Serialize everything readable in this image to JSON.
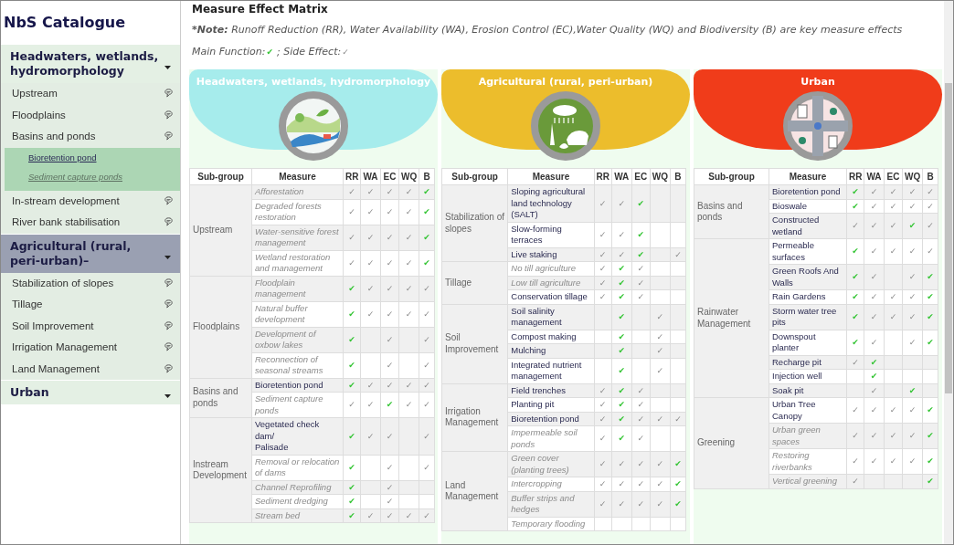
{
  "sidebar": {
    "title": "NbS Catalogue",
    "groups": [
      {
        "label": "Headwaters, wetlands, hydromorphology",
        "expanded": true,
        "selected": false,
        "items": [
          {
            "label": "Upstream",
            "expanded": false
          },
          {
            "label": "Floodplains",
            "expanded": false
          },
          {
            "label": "Basins and ponds",
            "expanded": true,
            "children": [
              {
                "label": "Bioretention pond",
                "disabled": false
              },
              {
                "label": "Sediment capture ponds",
                "disabled": true
              }
            ]
          },
          {
            "label": "In-stream development",
            "expanded": false
          },
          {
            "label": "River bank stabilisation",
            "expanded": false
          }
        ]
      },
      {
        "label": "Agricultural (rural, peri-urban)–",
        "expanded": true,
        "selected": true,
        "items": [
          {
            "label": "Stabilization of slopes",
            "expanded": false
          },
          {
            "label": "Tillage",
            "expanded": false
          },
          {
            "label": "Soil Improvement",
            "expanded": false
          },
          {
            "label": "Irrigation Management",
            "expanded": false
          },
          {
            "label": "Land Management",
            "expanded": false
          }
        ]
      },
      {
        "label": "Urban",
        "expanded": false,
        "selected": false
      }
    ]
  },
  "main": {
    "title": "Measure Effect Matrix",
    "note": {
      "label": "*Note:",
      "text": "Runoff Reduction (RR), Water Availability (WA), Erosion Control (EC),Water Quality (WQ) and Biodiversity (B) are key measure effects"
    },
    "legend": [
      {
        "label": "Main Function:",
        "mark": "✔",
        "main": true
      },
      {
        "label": "; Side Effect:",
        "mark": "✓",
        "main": false
      }
    ],
    "panels": [
      {
        "title": "Headwaters, wetlands, hydromorphology",
        "color": "#a6ecec",
        "columns": [
          "Sub-group",
          "Measure",
          "RR",
          "WA",
          "EC",
          "WQ",
          "B"
        ],
        "groups": [
          {
            "name": "Upstream",
            "measures": [
              {
                "name": "Afforestation",
                "disabled": true,
                "effects": {
                  "rr": {
                    "mark": "✓",
                    "main": false
                  },
                  "wa": {
                    "mark": "✓",
                    "main": false
                  },
                  "ec": {
                    "mark": "✓",
                    "main": false
                  },
                  "wq": {
                    "mark": "✓",
                    "main": false
                  },
                  "b": {
                    "mark": "✔",
                    "main": true
                  }
                }
              },
              {
                "name": "Degraded forests restoration",
                "disabled": true,
                "effects": {
                  "rr": {
                    "mark": "✓",
                    "main": false
                  },
                  "wa": {
                    "mark": "✓",
                    "main": false
                  },
                  "ec": {
                    "mark": "✓",
                    "main": false
                  },
                  "wq": {
                    "mark": "✓",
                    "main": false
                  },
                  "b": {
                    "mark": "✔",
                    "main": true
                  }
                }
              },
              {
                "name": "Water-sensitive forest management",
                "disabled": true,
                "effects": {
                  "rr": {
                    "mark": "✓",
                    "main": false
                  },
                  "wa": {
                    "mark": "✓",
                    "main": false
                  },
                  "ec": {
                    "mark": "✓",
                    "main": false
                  },
                  "wq": {
                    "mark": "✓",
                    "main": false
                  },
                  "b": {
                    "mark": "✔",
                    "main": true
                  }
                }
              },
              {
                "name": "Wetland restoration and management",
                "disabled": true,
                "effects": {
                  "rr": {
                    "mark": "✓",
                    "main": false
                  },
                  "wa": {
                    "mark": "✓",
                    "main": false
                  },
                  "ec": {
                    "mark": "✓",
                    "main": false
                  },
                  "wq": {
                    "mark": "✓",
                    "main": false
                  },
                  "b": {
                    "mark": "✔",
                    "main": true
                  }
                }
              }
            ]
          },
          {
            "name": "Floodplains",
            "measures": [
              {
                "name": "Floodplain management",
                "disabled": true,
                "effects": {
                  "rr": {
                    "mark": "✔",
                    "main": true
                  },
                  "wa": {
                    "mark": "✓",
                    "main": false
                  },
                  "ec": {
                    "mark": "✓",
                    "main": false
                  },
                  "wq": {
                    "mark": "✓",
                    "main": false
                  },
                  "b": {
                    "mark": "✓",
                    "main": false
                  }
                }
              },
              {
                "name": "Natural buffer development",
                "disabled": true,
                "effects": {
                  "rr": {
                    "mark": "✔",
                    "main": true
                  },
                  "wa": {
                    "mark": "✓",
                    "main": false
                  },
                  "ec": {
                    "mark": "✓",
                    "main": false
                  },
                  "wq": {
                    "mark": "✓",
                    "main": false
                  },
                  "b": {
                    "mark": "✓",
                    "main": false
                  }
                }
              },
              {
                "name": "Development of oxbow lakes",
                "disabled": true,
                "effects": {
                  "rr": {
                    "mark": "✔",
                    "main": true
                  },
                  "ec": {
                    "mark": "✓",
                    "main": false
                  },
                  "b": {
                    "mark": "✓",
                    "main": false
                  }
                }
              },
              {
                "name": "Reconnection of seasonal streams",
                "disabled": true,
                "effects": {
                  "rr": {
                    "mark": "✔",
                    "main": true
                  },
                  "ec": {
                    "mark": "✓",
                    "main": false
                  },
                  "b": {
                    "mark": "✓",
                    "main": false
                  }
                }
              }
            ]
          },
          {
            "name": "Basins and ponds",
            "measures": [
              {
                "name": "Bioretention pond",
                "disabled": false,
                "effects": {
                  "rr": {
                    "mark": "✔",
                    "main": true
                  },
                  "wa": {
                    "mark": "✓",
                    "main": false
                  },
                  "ec": {
                    "mark": "✓",
                    "main": false
                  },
                  "wq": {
                    "mark": "✓",
                    "main": false
                  },
                  "b": {
                    "mark": "✓",
                    "main": false
                  }
                }
              },
              {
                "name": "Sediment capture ponds",
                "disabled": true,
                "effects": {
                  "rr": {
                    "mark": "✓",
                    "main": false
                  },
                  "wa": {
                    "mark": "✓",
                    "main": false
                  },
                  "ec": {
                    "mark": "✔",
                    "main": true
                  },
                  "wq": {
                    "mark": "✓",
                    "main": false
                  },
                  "b": {
                    "mark": "✓",
                    "main": false
                  }
                }
              }
            ]
          },
          {
            "name": "Instream Development",
            "measures": [
              {
                "name": "Vegetated check dam/\nPalisade",
                "disabled": false,
                "effects": {
                  "rr": {
                    "mark": "✔",
                    "main": true
                  },
                  "wa": {
                    "mark": "✓",
                    "main": false
                  },
                  "ec": {
                    "mark": "✓",
                    "main": false
                  },
                  "b": {
                    "mark": "✓",
                    "main": false
                  }
                }
              },
              {
                "name": "Removal or relocation of dams",
                "disabled": true,
                "effects": {
                  "rr": {
                    "mark": "✔",
                    "main": true
                  },
                  "ec": {
                    "mark": "✓",
                    "main": false
                  },
                  "b": {
                    "mark": "✓",
                    "main": false
                  }
                }
              },
              {
                "name": "Channel Reprofiling",
                "disabled": true,
                "effects": {
                  "rr": {
                    "mark": "✔",
                    "main": true
                  },
                  "ec": {
                    "mark": "✓",
                    "main": false
                  }
                }
              },
              {
                "name": "Sediment dredging",
                "disabled": true,
                "effects": {
                  "rr": {
                    "mark": "✔",
                    "main": true
                  },
                  "ec": {
                    "mark": "✓",
                    "main": false
                  }
                }
              },
              {
                "name": "Stream bed",
                "disabled": true,
                "effects": {
                  "rr": {
                    "mark": "✔",
                    "main": true
                  },
                  "wa": {
                    "mark": "✓",
                    "main": false
                  },
                  "ec": {
                    "mark": "✓",
                    "main": false
                  },
                  "wq": {
                    "mark": "✓",
                    "main": false
                  },
                  "b": {
                    "mark": "✓",
                    "main": false
                  }
                }
              }
            ]
          }
        ]
      },
      {
        "title": "Agricultural (rural, peri-urban)",
        "color": "#ecbd2c",
        "columns": [
          "Sub-group",
          "Measure",
          "RR",
          "WA",
          "EC",
          "WQ",
          "B"
        ],
        "groups": [
          {
            "name": "Stabilization of slopes",
            "measures": [
              {
                "name": "Sloping agricultural land technology (SALT)",
                "disabled": false,
                "effects": {
                  "rr": {
                    "mark": "✓",
                    "main": false
                  },
                  "wa": {
                    "mark": "✓",
                    "main": false
                  },
                  "ec": {
                    "mark": "✔",
                    "main": true
                  }
                }
              },
              {
                "name": "Slow-forming terraces",
                "disabled": false,
                "effects": {
                  "rr": {
                    "mark": "✓",
                    "main": false
                  },
                  "wa": {
                    "mark": "✓",
                    "main": false
                  },
                  "ec": {
                    "mark": "✔",
                    "main": true
                  }
                }
              },
              {
                "name": "Live staking",
                "disabled": false,
                "effects": {
                  "rr": {
                    "mark": "✓",
                    "main": false
                  },
                  "wa": {
                    "mark": "✓",
                    "main": false
                  },
                  "ec": {
                    "mark": "✔",
                    "main": true
                  },
                  "b": {
                    "mark": "✓",
                    "main": false
                  }
                }
              }
            ]
          },
          {
            "name": "Tillage",
            "measures": [
              {
                "name": "No till agriculture",
                "disabled": true,
                "effects": {
                  "rr": {
                    "mark": "✓",
                    "main": false
                  },
                  "wa": {
                    "mark": "✔",
                    "main": true
                  },
                  "ec": {
                    "mark": "✓",
                    "main": false
                  }
                }
              },
              {
                "name": "Low till agriculture",
                "disabled": true,
                "effects": {
                  "rr": {
                    "mark": "✓",
                    "main": false
                  },
                  "wa": {
                    "mark": "✔",
                    "main": true
                  },
                  "ec": {
                    "mark": "✓",
                    "main": false
                  }
                }
              },
              {
                "name": "Conservation tillage",
                "disabled": false,
                "effects": {
                  "rr": {
                    "mark": "✓",
                    "main": false
                  },
                  "wa": {
                    "mark": "✔",
                    "main": true
                  },
                  "ec": {
                    "mark": "✓",
                    "main": false
                  }
                }
              }
            ]
          },
          {
            "name": "Soil Improvement",
            "measures": [
              {
                "name": "Soil salinity management",
                "disabled": false,
                "effects": {
                  "wa": {
                    "mark": "✔",
                    "main": true
                  },
                  "wq": {
                    "mark": "✓",
                    "main": false
                  }
                }
              },
              {
                "name": "Compost making",
                "disabled": false,
                "effects": {
                  "wa": {
                    "mark": "✔",
                    "main": true
                  },
                  "wq": {
                    "mark": "✓",
                    "main": false
                  }
                }
              },
              {
                "name": "Mulching",
                "disabled": false,
                "effects": {
                  "wa": {
                    "mark": "✔",
                    "main": true
                  },
                  "wq": {
                    "mark": "✓",
                    "main": false
                  }
                }
              },
              {
                "name": "Integrated nutrient management",
                "disabled": false,
                "effects": {
                  "wa": {
                    "mark": "✔",
                    "main": true
                  },
                  "wq": {
                    "mark": "✓",
                    "main": false
                  }
                }
              }
            ]
          },
          {
            "name": "Irrigation Management",
            "measures": [
              {
                "name": "Field trenches",
                "disabled": false,
                "effects": {
                  "rr": {
                    "mark": "✓",
                    "main": false
                  },
                  "wa": {
                    "mark": "✔",
                    "main": true
                  },
                  "ec": {
                    "mark": "✓",
                    "main": false
                  }
                }
              },
              {
                "name": "Planting pit",
                "disabled": false,
                "effects": {
                  "rr": {
                    "mark": "✓",
                    "main": false
                  },
                  "wa": {
                    "mark": "✔",
                    "main": true
                  },
                  "ec": {
                    "mark": "✓",
                    "main": false
                  }
                }
              },
              {
                "name": "Bioretention pond",
                "disabled": false,
                "effects": {
                  "rr": {
                    "mark": "✓",
                    "main": false
                  },
                  "wa": {
                    "mark": "✔",
                    "main": true
                  },
                  "ec": {
                    "mark": "✓",
                    "main": false
                  },
                  "wq": {
                    "mark": "✓",
                    "main": false
                  },
                  "b": {
                    "mark": "✓",
                    "main": false
                  }
                }
              },
              {
                "name": "Impermeable soil ponds",
                "disabled": true,
                "effects": {
                  "rr": {
                    "mark": "✓",
                    "main": false
                  },
                  "wa": {
                    "mark": "✔",
                    "main": true
                  },
                  "ec": {
                    "mark": "✓",
                    "main": false
                  }
                }
              }
            ]
          },
          {
            "name": "Land Management",
            "measures": [
              {
                "name": "Green cover (planting trees)",
                "disabled": true,
                "effects": {
                  "rr": {
                    "mark": "✓",
                    "main": false
                  },
                  "wa": {
                    "mark": "✓",
                    "main": false
                  },
                  "ec": {
                    "mark": "✓",
                    "main": false
                  },
                  "wq": {
                    "mark": "✓",
                    "main": false
                  },
                  "b": {
                    "mark": "✔",
                    "main": true
                  }
                }
              },
              {
                "name": "Intercropping",
                "disabled": true,
                "effects": {
                  "rr": {
                    "mark": "✓",
                    "main": false
                  },
                  "wa": {
                    "mark": "✓",
                    "main": false
                  },
                  "ec": {
                    "mark": "✓",
                    "main": false
                  },
                  "wq": {
                    "mark": "✓",
                    "main": false
                  },
                  "b": {
                    "mark": "✔",
                    "main": true
                  }
                }
              },
              {
                "name": "Buffer strips and hedges",
                "disabled": true,
                "effects": {
                  "rr": {
                    "mark": "✓",
                    "main": false
                  },
                  "wa": {
                    "mark": "✓",
                    "main": false
                  },
                  "ec": {
                    "mark": "✓",
                    "main": false
                  },
                  "wq": {
                    "mark": "✓",
                    "main": false
                  },
                  "b": {
                    "mark": "✔",
                    "main": true
                  }
                }
              },
              {
                "name": "Temporary flooding",
                "disabled": true
              }
            ]
          }
        ]
      },
      {
        "title": "Urban",
        "color": "#f03c1a",
        "columns": [
          "Sub-group",
          "Measure",
          "RR",
          "WA",
          "EC",
          "WQ",
          "B"
        ],
        "groups": [
          {
            "name": "Basins and ponds",
            "measures": [
              {
                "name": "Bioretention pond",
                "disabled": false,
                "effects": {
                  "rr": {
                    "mark": "✔",
                    "main": true
                  },
                  "wa": {
                    "mark": "✓",
                    "main": false
                  },
                  "ec": {
                    "mark": "✓",
                    "main": false
                  },
                  "wq": {
                    "mark": "✓",
                    "main": false
                  },
                  "b": {
                    "mark": "✓",
                    "main": false
                  }
                }
              },
              {
                "name": "Bioswale",
                "disabled": false,
                "effects": {
                  "rr": {
                    "mark": "✔",
                    "main": true
                  },
                  "wa": {
                    "mark": "✓",
                    "main": false
                  },
                  "ec": {
                    "mark": "✓",
                    "main": false
                  },
                  "wq": {
                    "mark": "✓",
                    "main": false
                  },
                  "b": {
                    "mark": "✓",
                    "main": false
                  }
                }
              },
              {
                "name": "Constructed wetland",
                "disabled": false,
                "effects": {
                  "rr": {
                    "mark": "✓",
                    "main": false
                  },
                  "wa": {
                    "mark": "✓",
                    "main": false
                  },
                  "ec": {
                    "mark": "✓",
                    "main": false
                  },
                  "wq": {
                    "mark": "✔",
                    "main": true
                  },
                  "b": {
                    "mark": "✓",
                    "main": false
                  }
                }
              }
            ]
          },
          {
            "name": "Rainwater Management",
            "measures": [
              {
                "name": "Permeable surfaces",
                "disabled": false,
                "effects": {
                  "rr": {
                    "mark": "✔",
                    "main": true
                  },
                  "wa": {
                    "mark": "✓",
                    "main": false
                  },
                  "ec": {
                    "mark": "✓",
                    "main": false
                  },
                  "wq": {
                    "mark": "✓",
                    "main": false
                  },
                  "b": {
                    "mark": "✓",
                    "main": false
                  }
                }
              },
              {
                "name": "Green Roofs And Walls",
                "disabled": false,
                "effects": {
                  "rr": {
                    "mark": "✔",
                    "main": true
                  },
                  "wa": {
                    "mark": "✓",
                    "main": false
                  },
                  "wq": {
                    "mark": "✓",
                    "main": false
                  },
                  "b": {
                    "mark": "✔",
                    "main": true
                  }
                }
              },
              {
                "name": "Rain Gardens",
                "disabled": false,
                "effects": {
                  "rr": {
                    "mark": "✔",
                    "main": true
                  },
                  "wa": {
                    "mark": "✓",
                    "main": false
                  },
                  "ec": {
                    "mark": "✓",
                    "main": false
                  },
                  "wq": {
                    "mark": "✓",
                    "main": false
                  },
                  "b": {
                    "mark": "✔",
                    "main": true
                  }
                }
              },
              {
                "name": "Storm water tree pits",
                "disabled": false,
                "effects": {
                  "rr": {
                    "mark": "✔",
                    "main": true
                  },
                  "wa": {
                    "mark": "✓",
                    "main": false
                  },
                  "ec": {
                    "mark": "✓",
                    "main": false
                  },
                  "wq": {
                    "mark": "✓",
                    "main": false
                  },
                  "b": {
                    "mark": "✔",
                    "main": true
                  }
                }
              },
              {
                "name": "Downspout planter",
                "disabled": false,
                "effects": {
                  "rr": {
                    "mark": "✔",
                    "main": true
                  },
                  "wa": {
                    "mark": "✓",
                    "main": false
                  },
                  "wq": {
                    "mark": "✓",
                    "main": false
                  },
                  "b": {
                    "mark": "✔",
                    "main": true
                  }
                }
              },
              {
                "name": "Recharge pit",
                "disabled": false,
                "effects": {
                  "rr": {
                    "mark": "✓",
                    "main": false
                  },
                  "wa": {
                    "mark": "✔",
                    "main": true
                  }
                }
              },
              {
                "name": "Injection well",
                "disabled": false,
                "effects": {
                  "wa": {
                    "mark": "✔",
                    "main": true
                  }
                }
              },
              {
                "name": "Soak pit",
                "disabled": false,
                "effects": {
                  "wa": {
                    "mark": "✓",
                    "main": false
                  },
                  "wq": {
                    "mark": "✔",
                    "main": true
                  }
                }
              }
            ]
          },
          {
            "name": "Greening",
            "measures": [
              {
                "name": "Urban Tree Canopy",
                "disabled": false,
                "effects": {
                  "rr": {
                    "mark": "✓",
                    "main": false
                  },
                  "wa": {
                    "mark": "✓",
                    "main": false
                  },
                  "ec": {
                    "mark": "✓",
                    "main": false
                  },
                  "wq": {
                    "mark": "✓",
                    "main": false
                  },
                  "b": {
                    "mark": "✔",
                    "main": true
                  }
                }
              },
              {
                "name": "Urban green spaces",
                "disabled": true,
                "effects": {
                  "rr": {
                    "mark": "✓",
                    "main": false
                  },
                  "wa": {
                    "mark": "✓",
                    "main": false
                  },
                  "ec": {
                    "mark": "✓",
                    "main": false
                  },
                  "wq": {
                    "mark": "✓",
                    "main": false
                  },
                  "b": {
                    "mark": "✔",
                    "main": true
                  }
                }
              },
              {
                "name": "Restoring riverbanks",
                "disabled": true,
                "effects": {
                  "rr": {
                    "mark": "✓",
                    "main": false
                  },
                  "wa": {
                    "mark": "✓",
                    "main": false
                  },
                  "ec": {
                    "mark": "✓",
                    "main": false
                  },
                  "wq": {
                    "mark": "✓",
                    "main": false
                  },
                  "b": {
                    "mark": "✔",
                    "main": true
                  }
                }
              },
              {
                "name": "Vertical greening",
                "disabled": true,
                "effects": {
                  "rr": {
                    "mark": "✓",
                    "main": false
                  },
                  "b": {
                    "mark": "✔",
                    "main": true
                  }
                }
              }
            ]
          }
        ]
      }
    ]
  }
}
